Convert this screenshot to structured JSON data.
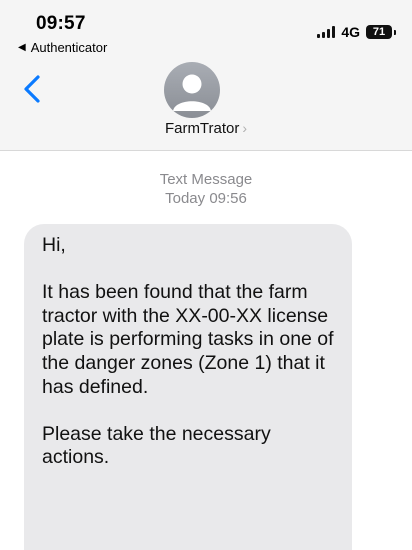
{
  "status_bar": {
    "time": "09:57",
    "back_app": "Authenticator",
    "network": "4G",
    "battery": "71"
  },
  "header": {
    "contact_name": "FarmTrator"
  },
  "conversation": {
    "message_type": "Text Message",
    "timestamp": "Today 09:56",
    "message": {
      "greeting": "Hi,",
      "body": "It has been found that the farm tractor with the XX-00-XX license plate is performing tasks in one of the danger zones (Zone 1) that it has defined.",
      "closing": "Please take the necessary actions."
    }
  },
  "colors": {
    "accent": "#0a7aff",
    "bubble": "#e9e9eb",
    "meta_text": "#8a8a8e"
  },
  "icons": {
    "back": "chevron-left-icon",
    "avatar": "person-avatar-icon",
    "contact_chevron": "chevron-right-icon"
  }
}
